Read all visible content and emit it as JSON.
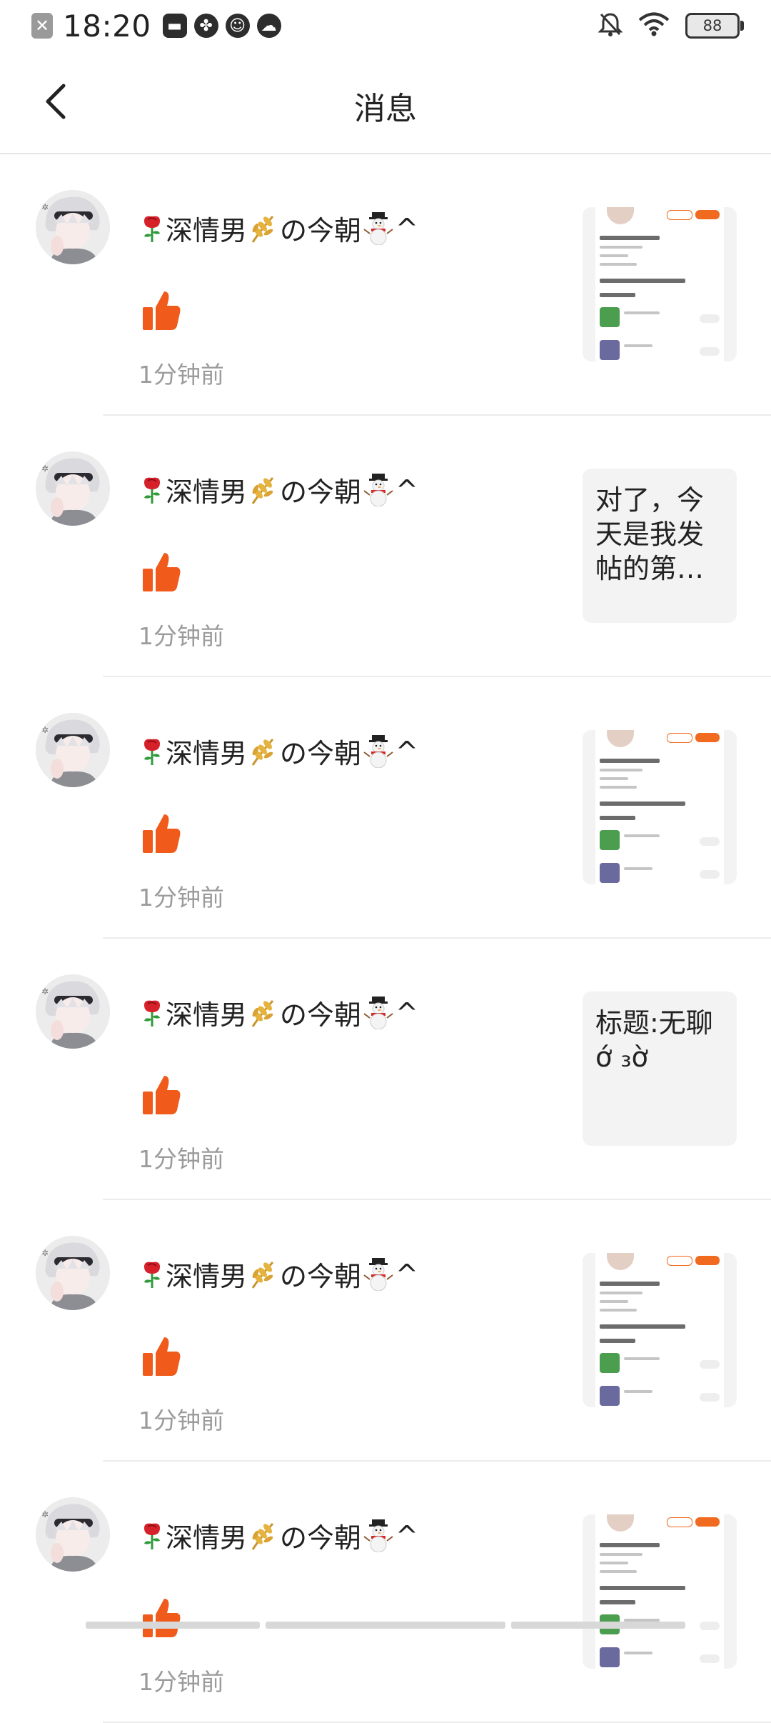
{
  "status_bar": {
    "time": "18:20",
    "battery": "88",
    "icons": [
      "close-notification-icon",
      "mail-icon",
      "fan-app-icon",
      "bot-app-icon",
      "cloud-icon",
      "bell-muted-icon",
      "wifi-icon",
      "battery-icon"
    ]
  },
  "header": {
    "title": "消息",
    "back_icon": "chevron-left-icon"
  },
  "messages": [
    {
      "name": "深情男",
      "name_suffix": "の今朝",
      "name_end": "^",
      "time": "1分钟前",
      "action_icon": "thumbs-up-icon",
      "preview_type": "screenshot",
      "preview_text": ""
    },
    {
      "name": "深情男",
      "name_suffix": "の今朝",
      "name_end": "^",
      "time": "1分钟前",
      "action_icon": "thumbs-up-icon",
      "preview_type": "text",
      "preview_text": "对了，今天是我发帖的第…"
    },
    {
      "name": "深情男",
      "name_suffix": "の今朝",
      "name_end": "^",
      "time": "1分钟前",
      "action_icon": "thumbs-up-icon",
      "preview_type": "screenshot",
      "preview_text": ""
    },
    {
      "name": "深情男",
      "name_suffix": "の今朝",
      "name_end": "^",
      "time": "1分钟前",
      "action_icon": "thumbs-up-icon",
      "preview_type": "text",
      "preview_text": "标题:无聊ớ ₃ờ"
    },
    {
      "name": "深情男",
      "name_suffix": "の今朝",
      "name_end": "^",
      "time": "1分钟前",
      "action_icon": "thumbs-up-icon",
      "preview_type": "screenshot",
      "preview_text": ""
    },
    {
      "name": "深情男",
      "name_suffix": "の今朝",
      "name_end": "^",
      "time": "1分钟前",
      "action_icon": "thumbs-up-icon",
      "preview_type": "screenshot",
      "preview_text": ""
    }
  ],
  "colors": {
    "accent": "#F05A1A",
    "text_primary": "#222222",
    "text_secondary": "#9B9B9B",
    "divider": "#ECECEC",
    "preview_bg": "#F3F3F3"
  }
}
